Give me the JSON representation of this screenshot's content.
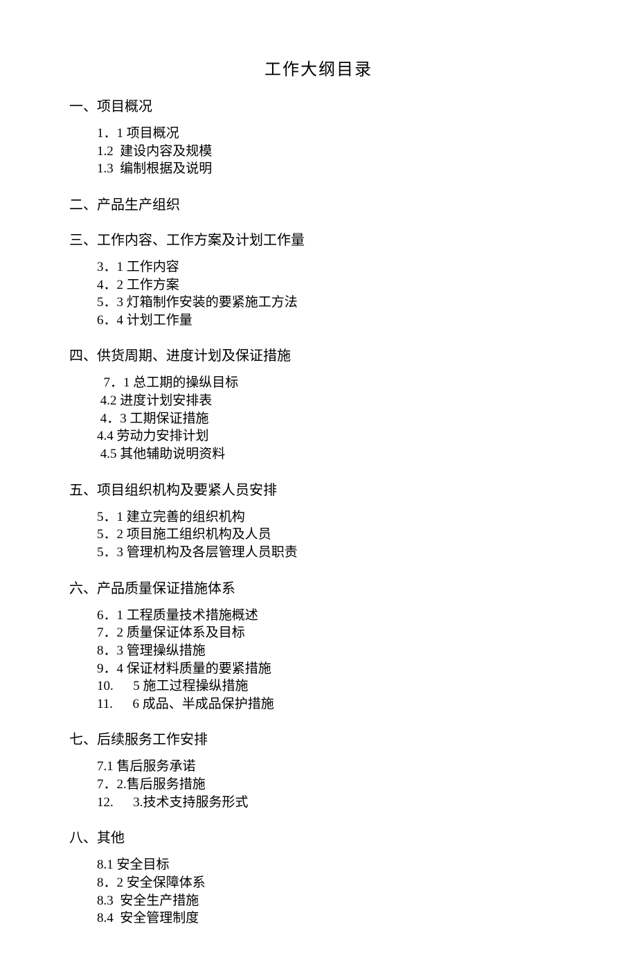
{
  "title": "工作大纲目录",
  "sections": [
    {
      "heading": "一、项目概况",
      "items": [
        "1．1 项目概况",
        "1.2  建设内容及规模",
        "1.3  编制根据及说明"
      ]
    },
    {
      "heading": "二、产品生产组织",
      "items": []
    },
    {
      "heading": "三、工作内容、工作方案及计划工作量",
      "items": [
        "3．1 工作内容",
        "4．2 工作方案",
        "5．3 灯箱制作安装的要紧施工方法",
        "6．4 计划工作量"
      ]
    },
    {
      "heading": "四、供货周期、进度计划及保证措施",
      "items": [
        "  7．1 总工期的操纵目标",
        " 4.2 进度计划安排表",
        " 4．3 工期保证措施",
        "4.4 劳动力安排计划",
        " 4.5 其他辅助说明资料"
      ]
    },
    {
      "heading": "五、项目组织机构及要紧人员安排",
      "items": [
        "5．1 建立完善的组织机构",
        "5．2 项目施工组织机构及人员",
        "5．3 管理机构及各层管理人员职责"
      ]
    },
    {
      "heading": "六、产品质量保证措施体系",
      "items": [
        "6．1 工程质量技术措施概述",
        "7．2 质量保证体系及目标",
        "8．3 管理操纵措施",
        "9．4 保证材料质量的要紧措施",
        "10.      5 施工过程操纵措施",
        "11.      6 成品、半成品保护措施"
      ]
    },
    {
      "heading": "七、后续服务工作安排",
      "items": [
        "7.1 售后服务承诺",
        "7．2.售后服务措施",
        "12.      3.技术支持服务形式"
      ]
    },
    {
      "heading": "八、其他",
      "items": [
        "8.1 安全目标",
        "8．2 安全保障体系",
        "8.3  安全生产措施",
        "8.4  安全管理制度"
      ]
    }
  ]
}
